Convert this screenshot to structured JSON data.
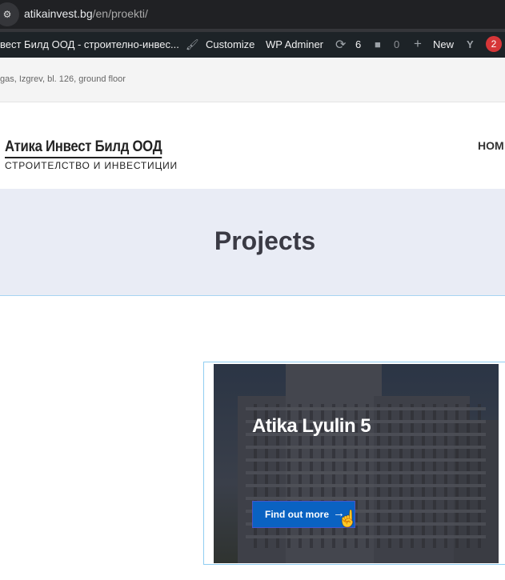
{
  "browser": {
    "url_host": "atikainvest.bg",
    "url_path": "/en/proekti/"
  },
  "admin_bar": {
    "site_name": "вест Билд ООД - строително-инвес...",
    "customize": "Customize",
    "wp_adminer": "WP Adminer",
    "updates_count": "6",
    "comments_count": "0",
    "new_label": "New",
    "notifications_count": "2"
  },
  "info_bar": {
    "address": "gas, Izgrev, bl. 126, ground floor"
  },
  "header": {
    "logo_title": "Атика Инвест Билд ООД",
    "logo_subtitle": "СТРОИТЕЛСТВО И ИНВЕСТИЦИИ",
    "nav_home": "HOM"
  },
  "page": {
    "title": "Projects"
  },
  "project_card": {
    "title": "Atika Lyulin 5",
    "button_label": "Find out more",
    "button_arrow": "→"
  },
  "colors": {
    "admin_bar": "#1d2327",
    "button": "#0a62c2",
    "title_band": "#e9ecf5",
    "badge": "#d63638"
  }
}
